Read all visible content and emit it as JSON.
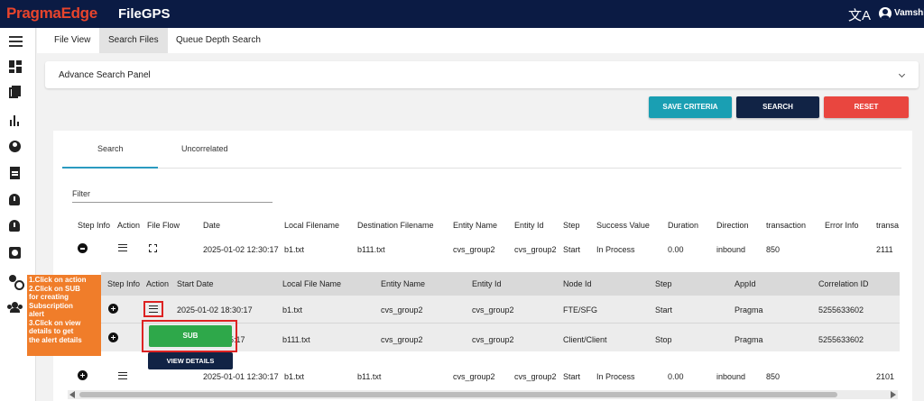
{
  "header": {
    "brand": "PragmaEdge",
    "app_name": "FileGPS",
    "user": "Vamshi"
  },
  "top_tabs": [
    "File View",
    "Search Files",
    "Queue Depth Search"
  ],
  "advance_search": {
    "title": "Advance Search Panel"
  },
  "actions": {
    "save": "SAVE CRITERIA",
    "search": "SEARCH",
    "reset": "RESET"
  },
  "result_tabs": [
    "Search",
    "Uncorrelated"
  ],
  "filter_label": "Filter",
  "main_table": {
    "headers": [
      "Step Info",
      "Action",
      "File Flow",
      "Date",
      "Local Filename",
      "Destination Filename",
      "Entity Name",
      "Entity Id",
      "Step",
      "Success Value",
      "Duration",
      "Direction",
      "transaction",
      "Error Info",
      "transa"
    ],
    "row1": [
      "2025-01-02 12:30:17",
      "b1.txt",
      "b111.txt",
      "cvs_group2",
      "cvs_group2",
      "Start",
      "In Process",
      "0.00",
      "inbound",
      "850",
      "2111"
    ],
    "row2": [
      "2025-01-01 12:30:17",
      "b1.txt",
      "b11.txt",
      "cvs_group2",
      "cvs_group2",
      "Start",
      "In Process",
      "0.00",
      "inbound",
      "850",
      "2101"
    ]
  },
  "sub_table": {
    "headers": [
      "Step Info",
      "Action",
      "Start Date",
      "Local File Name",
      "Entity Name",
      "Entity Id",
      "Node Id",
      "Step",
      "AppId",
      "Correlation ID"
    ],
    "row1": [
      "2025-01-02 18:30:17",
      "b1.txt",
      "cvs_group2",
      "cvs_group2",
      "FTE/SFG",
      "Start",
      "Pragma",
      "5255633602"
    ],
    "row2": [
      "5:17",
      "b111.txt",
      "cvs_group2",
      "cvs_group2",
      "Client/Client",
      "Stop",
      "Pragma",
      "5255633602"
    ]
  },
  "popup": {
    "sub": "SUB",
    "view": "VIEW DETAILS"
  },
  "annotation": [
    "1.Click on action",
    "2.Click on SUB for creating Subscription alert",
    "3.Click on view details to get the alert details"
  ],
  "annotation_lines": [
    "1.Click on action",
    "2.Click on SUB",
    "for creating",
    "Subscription",
    "alert",
    "3.Click on view",
    "details to get",
    "the alert details"
  ],
  "row2_date_partial": "2025-01-01 12:30:17",
  "colors": {
    "topbar": "#0b1b44",
    "brand": "#e8442c",
    "save": "#1a9fb3",
    "search": "#112345",
    "reset": "#e9463f",
    "sub": "#2ea84a",
    "note": "#f07d2a",
    "highlight": "#dd2222"
  }
}
